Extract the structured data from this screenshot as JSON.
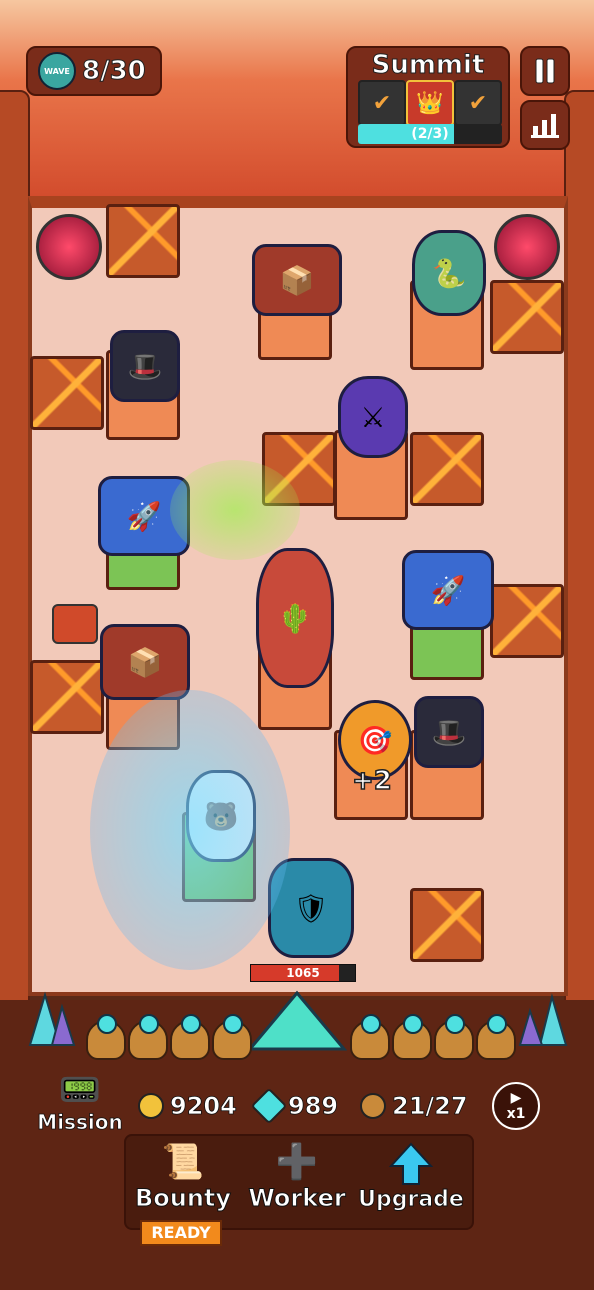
{
  "hud": {
    "wave_label": "WAVE",
    "wave": "8/30",
    "summit_title": "Summit",
    "summit_progress_text": "(2/3)",
    "summit_progress": 0.67
  },
  "boss": {
    "hp": "1065",
    "hp_fraction": 0.85
  },
  "floating_text": "+2",
  "resources": {
    "gold": "9204",
    "gems": "989",
    "workers": "21/27"
  },
  "mission_label": "Mission",
  "speed_label": "x1",
  "actions": {
    "bounty_label": "Bounty",
    "bounty_status": "READY",
    "worker_label": "Worker",
    "upgrade_label": "Upgrade"
  },
  "colors": {
    "accent": "#4ee0e0",
    "gold": "#f2c23b",
    "ready": "#f28a1c",
    "hp": "#d63a2a"
  }
}
